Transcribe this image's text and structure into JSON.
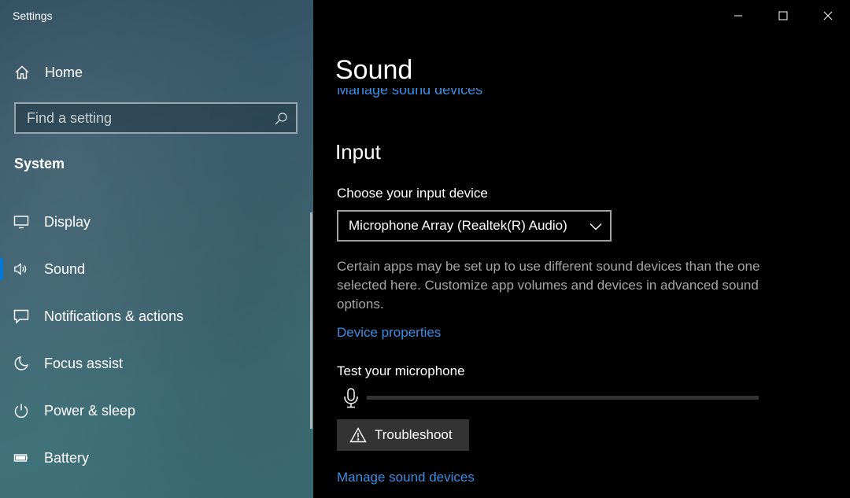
{
  "window": {
    "title": "Settings"
  },
  "sidebar": {
    "home_label": "Home",
    "search": {
      "placeholder": "Find a setting",
      "value": ""
    },
    "section_title": "System",
    "items": [
      {
        "label": "Display",
        "icon": "monitor-icon",
        "active": false
      },
      {
        "label": "Sound",
        "icon": "speaker-icon",
        "active": true
      },
      {
        "label": "Notifications & actions",
        "icon": "notification-icon",
        "active": false
      },
      {
        "label": "Focus assist",
        "icon": "moon-icon",
        "active": false
      },
      {
        "label": "Power & sleep",
        "icon": "power-icon",
        "active": false
      },
      {
        "label": "Battery",
        "icon": "battery-icon",
        "active": false
      }
    ]
  },
  "main": {
    "page_title": "Sound",
    "cutoff_link": "Manage sound devices",
    "input": {
      "heading": "Input",
      "choose_label": "Choose your input device",
      "selected_device": "Microphone Array (Realtek(R) Audio)",
      "help_text": "Certain apps may be set up to use different sound devices than the one selected here. Customize app volumes and devices in advanced sound options.",
      "device_properties_link": "Device properties",
      "test_label": "Test your microphone",
      "mic_level": 0,
      "troubleshoot_label": "Troubleshoot",
      "manage_link": "Manage sound devices"
    }
  },
  "colors": {
    "accent": "#0078d7",
    "link": "#3a8ee6",
    "background": "#000000"
  }
}
